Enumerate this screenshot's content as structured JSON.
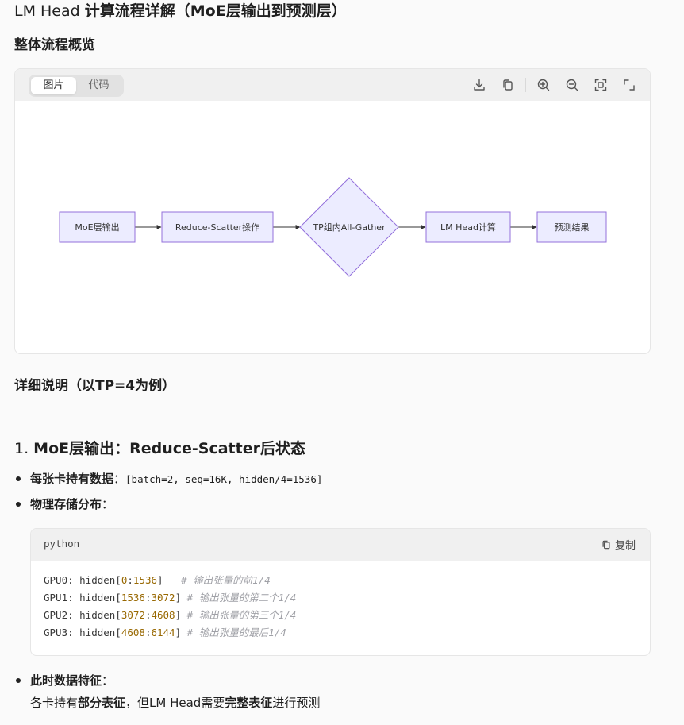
{
  "page": {
    "title_prefix": "LM Head ",
    "title_main": "计算流程详解（MoE层输出到预测层）"
  },
  "overview": {
    "heading": "整体流程概览",
    "tabs": [
      {
        "label": "图片"
      },
      {
        "label": "代码"
      }
    ],
    "tools": [
      "download-icon",
      "copy-icon",
      "zoom-in-icon",
      "zoom-out-icon",
      "fit-view-icon",
      "fullscreen-icon"
    ],
    "nodes": [
      {
        "label": "MoE层输出"
      },
      {
        "label": "Reduce-Scatter操作"
      },
      {
        "label": "TP组内All-Gather"
      },
      {
        "label": "LM Head计算"
      },
      {
        "label": "预测结果"
      }
    ]
  },
  "detail": {
    "heading": "详细说明（以TP=4为例）"
  },
  "section1": {
    "heading_prefix": "1. ",
    "heading": "MoE层输出：Reduce-Scatter后状态",
    "bullet1_label": "每张卡持有数据",
    "bullet1_sep": "：",
    "bullet1_code": "[batch=2, seq=16K, hidden/4=1536]",
    "bullet2_label": "物理存储分布",
    "bullet2_sep": "：",
    "code": {
      "lang": "python",
      "copy_label": "复制",
      "lines": [
        {
          "pre": "GPU0: hidden[",
          "a": "0",
          "colon": ":",
          "b": "1536",
          "post": "]   ",
          "comment": "# 输出张量的前1/4"
        },
        {
          "pre": "GPU1: hidden[",
          "a": "1536",
          "colon": ":",
          "b": "3072",
          "post": "] ",
          "comment": "# 输出张量的第二个1/4"
        },
        {
          "pre": "GPU2: hidden[",
          "a": "3072",
          "colon": ":",
          "b": "4608",
          "post": "] ",
          "comment": "# 输出张量的第三个1/4"
        },
        {
          "pre": "GPU3: hidden[",
          "a": "4608",
          "colon": ":",
          "b": "6144",
          "post": "] ",
          "comment": "# 输出张量的最后1/4"
        }
      ]
    },
    "bullet3_label": "此时数据特征",
    "bullet3_sep": "：",
    "bullet3_text_a": "各卡持有",
    "bullet3_bold_a": "部分表征",
    "bullet3_text_b": "，但LM Head需要",
    "bullet3_bold_b": "完整表征",
    "bullet3_text_c": "进行预测"
  }
}
